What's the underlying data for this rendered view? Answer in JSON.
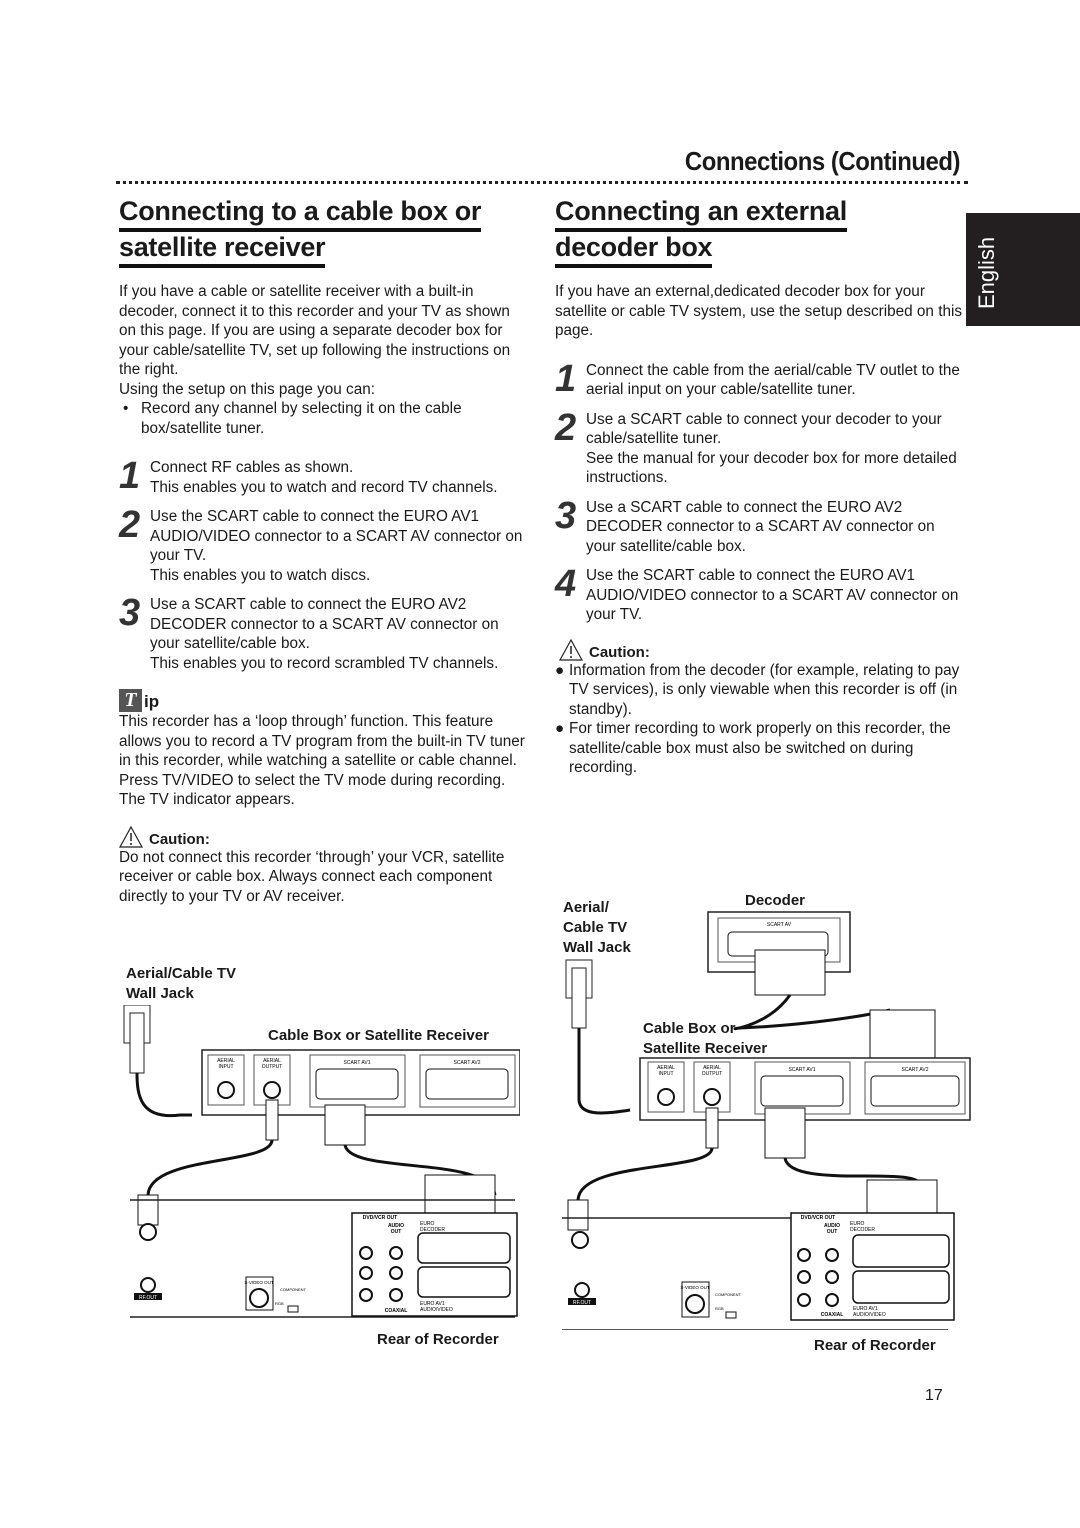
{
  "header": {
    "running_title": "Connections (Continued)",
    "language_tab": "English"
  },
  "left": {
    "title_line1": "Connecting to a cable box or",
    "title_line2": "satellite receiver",
    "intro": "If you have a cable or satellite receiver with a built-in decoder, connect it to this recorder and your TV as shown on this page. If you are using a separate decoder box for your cable/satellite TV, set up following the instructions on the right.",
    "using": "Using the setup on this page you can:",
    "bullet": "Record any channel by selecting it on the cable box/satellite tuner.",
    "steps": [
      {
        "num": "1",
        "text": "Connect RF cables as shown.",
        "note": "This enables you to watch and record TV channels."
      },
      {
        "num": "2",
        "text": "Use the SCART cable to connect the EURO AV1 AUDIO/VIDEO connector to a SCART AV connector on your TV.",
        "note": "This enables you to watch discs."
      },
      {
        "num": "3",
        "text": "Use a SCART cable to connect the EURO AV2 DECODER connector to a SCART AV connector on your satellite/cable box.",
        "note": "This enables you to record scrambled TV channels."
      }
    ],
    "tip_letter": "T",
    "tip_label": "ip",
    "tip_text": "This recorder has a ‘loop through’ function. This feature allows you to record a TV program from the built-in TV tuner in this recorder, while watching a satellite or cable channel. Press TV/VIDEO to select the TV mode during recording. The TV indicator appears.",
    "caution_label": "Caution:",
    "caution_text": "Do not connect this recorder ‘through’ your VCR, satellite receiver or cable box. Always connect each component directly to your TV or AV receiver."
  },
  "right": {
    "title_line1": "Connecting an external",
    "title_line2": "decoder box",
    "intro": "If you have an external,dedicated decoder box for your satellite or cable TV system, use the setup described on this page.",
    "steps": [
      {
        "num": "1",
        "text": "Connect the cable from the aerial/cable TV outlet to the aerial input on your cable/satellite tuner.",
        "note": ""
      },
      {
        "num": "2",
        "text": "Use a SCART cable to connect your decoder to your cable/satellite tuner.",
        "note": "See the manual for your decoder box for more detailed instructions."
      },
      {
        "num": "3",
        "text": "Use a SCART cable to connect the EURO AV2 DECODER connector to a SCART AV connector on your satellite/cable box.",
        "note": ""
      },
      {
        "num": "4",
        "text": "Use the SCART cable to connect the EURO AV1 AUDIO/VIDEO connector to a SCART AV connector on your TV.",
        "note": ""
      }
    ],
    "caution_label": "Caution:",
    "caution_bullets": [
      "Information from the decoder (for example, relating to pay TV services), is only viewable when this recorder is off (in standby).",
      "For timer recording to work properly on this recorder, the satellite/cable box must also be switched on during recording."
    ]
  },
  "diagram_left": {
    "wall_jack_label_1": "Aerial/Cable TV",
    "wall_jack_label_2": "Wall Jack",
    "receiver_label": "Cable Box or Satellite Receiver",
    "aerial_input": [
      "AERIAL",
      "INPUT"
    ],
    "aerial_output": [
      "AERIAL",
      "OUTPUT"
    ],
    "scart_av1": "SCART AV1",
    "scart_av2": "SCART AV2",
    "recorder_label": "Rear of Recorder"
  },
  "diagram_right": {
    "wall_jack_label_1": "Aerial/",
    "wall_jack_label_2": "Cable TV",
    "wall_jack_label_3": "Wall Jack",
    "decoder_label": "Decoder",
    "decoder_scart": "SCART AV",
    "receiver_label_1": "Cable Box or",
    "receiver_label_2": "Satellite Receiver",
    "aerial_input": [
      "AERIAL",
      "INPUT"
    ],
    "aerial_output": [
      "AERIAL",
      "OUTPUT"
    ],
    "scart_av1": "SCART AV1",
    "scart_av2": "SCART AV2",
    "recorder_label": "Rear of Recorder"
  },
  "recorder_panel": {
    "dvd_vcr_out": "DVD/VCR OUT",
    "audio_out": [
      "AUDIO",
      "OUT"
    ],
    "coaxial": "COAXIAL",
    "euro_av1": [
      "EURO AV1",
      "AUDIO/VIDEO"
    ],
    "euro_av2": [
      "EURO",
      "DECODER"
    ],
    "s_video_out": "S-VIDEO OUT",
    "component": "COMPONENT",
    "rgb": "RGB",
    "rf_out": "RF.OUT"
  },
  "footer": {
    "page_number": "17"
  }
}
